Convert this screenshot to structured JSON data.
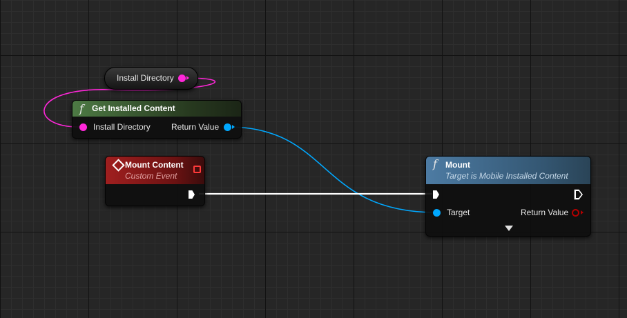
{
  "colors": {
    "background": "#262626",
    "pin_pink": "#ff27d9",
    "pin_blue": "#00a8ff",
    "pin_red": "#8c0000",
    "func_header": "#3a5f33",
    "event_header": "#8a1a1a",
    "mount_header": "#3f6a8c",
    "exec_wire": "#ffffff"
  },
  "nodes": {
    "install_directory_var": {
      "label": "Install Directory"
    },
    "get_installed_content": {
      "title": "Get Installed Content",
      "icon": "function-icon",
      "inputs": [
        "Install Directory"
      ],
      "outputs": [
        "Return Value"
      ]
    },
    "mount_content": {
      "title": "Mount Content",
      "subtitle": "Custom Event",
      "icon": "event-diamond-icon"
    },
    "mount": {
      "title": "Mount",
      "subtitle": "Target is Mobile Installed Content",
      "icon": "function-icon",
      "inputs": [
        "Target"
      ],
      "outputs": [
        "Return Value"
      ]
    }
  }
}
